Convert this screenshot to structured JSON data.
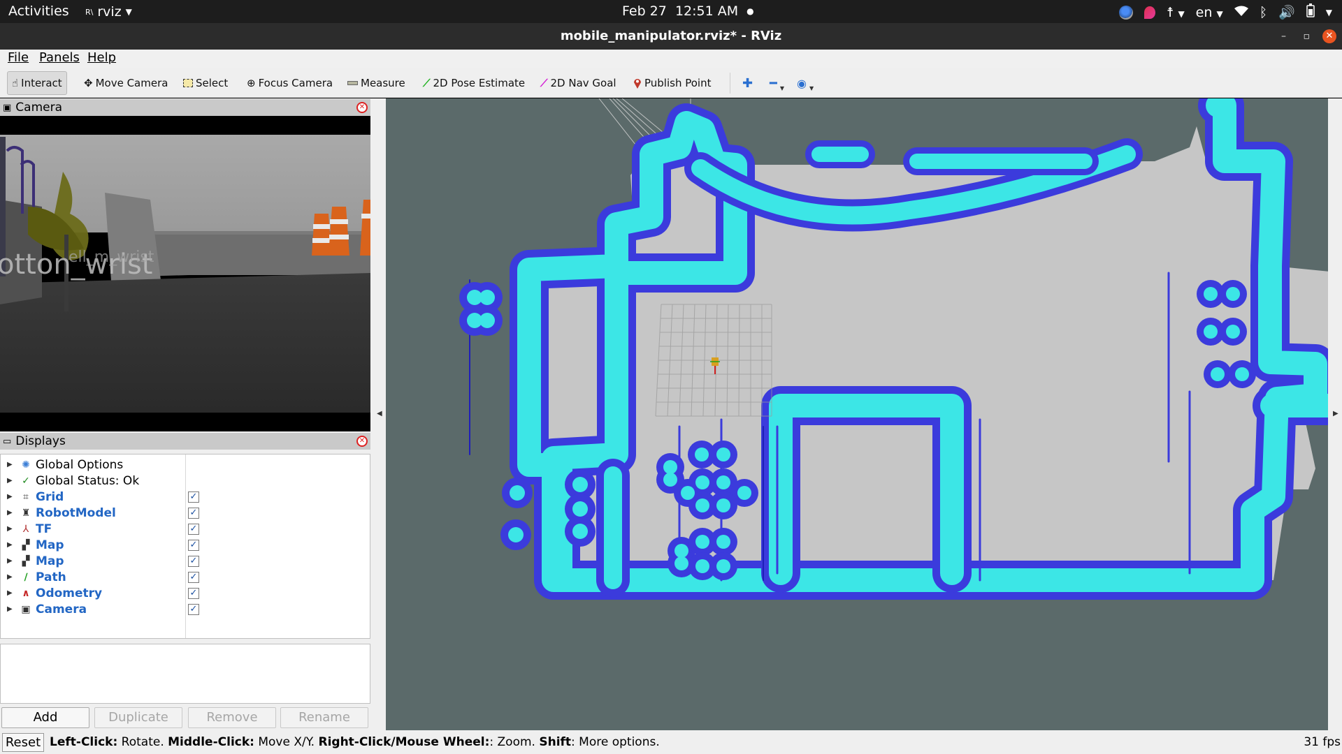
{
  "topbar": {
    "activities": "Activities",
    "app_name": "rviz",
    "app_icon_text": "R\\",
    "date": "Feb 27",
    "time": "12:51 AM",
    "lang": "en"
  },
  "window": {
    "title": "mobile_manipulator.rviz* - RViz",
    "minimize": "–",
    "maximize": "▫",
    "close": "✕"
  },
  "menu": {
    "file": "File",
    "panels": "Panels",
    "help": "Help"
  },
  "toolbar": {
    "interact": "Interact",
    "move_camera": "Move Camera",
    "select": "Select",
    "focus_camera": "Focus Camera",
    "measure": "Measure",
    "pose_estimate": "2D Pose Estimate",
    "nav_goal": "2D Nav Goal",
    "publish_point": "Publish Point"
  },
  "camera_panel": {
    "title": "Camera",
    "overlay_big": "otton_wrist",
    "overlay_small": "ell_m_wrist"
  },
  "displays_panel": {
    "title": "Displays",
    "items": [
      {
        "label": "Global Options",
        "icon": "gear-icon",
        "enabled": null
      },
      {
        "label": "Global Status: Ok",
        "icon": "checkmark-icon",
        "enabled": null
      },
      {
        "label": "Grid",
        "icon": "grid-icon",
        "enabled": true
      },
      {
        "label": "RobotModel",
        "icon": "robot-icon",
        "enabled": true
      },
      {
        "label": "TF",
        "icon": "axes-icon",
        "enabled": true
      },
      {
        "label": "Map",
        "icon": "map-icon",
        "enabled": true
      },
      {
        "label": "Map",
        "icon": "map-icon",
        "enabled": true
      },
      {
        "label": "Path",
        "icon": "path-icon",
        "enabled": true
      },
      {
        "label": "Odometry",
        "icon": "odometry-icon",
        "enabled": true
      },
      {
        "label": "Camera",
        "icon": "camera-icon",
        "enabled": true
      }
    ],
    "check_mark": "✓",
    "buttons": {
      "add": "Add",
      "duplicate": "Duplicate",
      "remove": "Remove",
      "rename": "Rename"
    }
  },
  "status": {
    "reset": "Reset",
    "lc_key": "Left-Click:",
    "lc_val": " Rotate. ",
    "mc_key": "Middle-Click:",
    "mc_val": " Move X/Y. ",
    "rc_key": "Right-Click/Mouse Wheel:",
    "rc_val": ": Zoom. ",
    "sh_key": "Shift",
    "sh_val": ": More options.",
    "fps": "31 fps"
  },
  "colors": {
    "map_fill": "#c6c6c6",
    "background": "#5b6a6a",
    "inflation": "#3a3ad8",
    "cost": "#39e4e4",
    "accent": "#e95420"
  }
}
